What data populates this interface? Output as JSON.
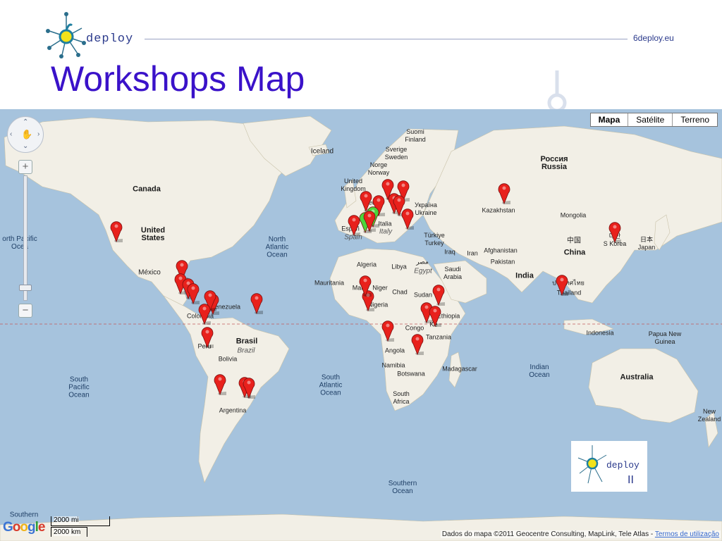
{
  "slide": {
    "brand": "deploy",
    "site": "6deploy.eu",
    "title": "Workshops Map"
  },
  "map": {
    "type_buttons": [
      "Mapa",
      "Satélite",
      "Terreno"
    ],
    "selected_type": "Mapa",
    "scale": {
      "top": "2000 mi",
      "bottom": "2000 km"
    },
    "attribution": "Dados do mapa ©2011 Geocentre Consulting, MapLink, Tele Atlas -",
    "terms_link": "Termos de utilização",
    "google_logo": "Google",
    "labels": {
      "canada": "Canada",
      "united_states": "United\nStates",
      "mexico": "México",
      "north_atlantic": "North\nAtlantic\nOcean",
      "north_pacific": "orth Pacific\nOcea",
      "venezuela": "Venezuela",
      "colombia": "Colombia",
      "peru": "Peru",
      "brasil": "Brasil",
      "brazil": "Brazil",
      "bolivia": "Bolivia",
      "argentina": "Argentina",
      "south_pacific": "South\nPacific\nOcean",
      "south_atlantic": "South\nAtlantic\nOcean",
      "southern_ocean": "Southern\nOcean",
      "southern_ocean_left": "Southern",
      "iceland": "Iceland",
      "suomi": "Suomi\nFinland",
      "sverige": "Sverige\nSweden",
      "norge": "Norge\nNorway",
      "united_kingdom": "United\nKingdom",
      "deutschland": "Deuts",
      "espana": "Españ",
      "spain": "Spain",
      "italia": "Italia",
      "italy": "Italy",
      "ukraina": "Україна\nUkraine",
      "turkiye": "Türkiye\nTurkey",
      "rossiya": "Россия\nRussia",
      "kazakhstan": "Kazakhstan",
      "mongolia": "Mongolia",
      "china_native": "中国",
      "china": "China",
      "korea_native": "대한\nS Korea",
      "japan_native": "日本\nJapan",
      "iraq": "Iraq",
      "iran": "Iran",
      "afghanistan": "Afghanistan",
      "pakistan": "Pakistan",
      "india": "India",
      "thailand": "Thailand",
      "thailand_native": "ประเทศไทย",
      "algeria": "Algeria",
      "libya": "Libya",
      "egypt_native": "مصر",
      "egypt": "Egypt",
      "saudi": "Saudi\nArabia",
      "mauritania": "Mauritania",
      "mali": "Mali",
      "niger": "Niger",
      "chad": "Chad",
      "sudan": "Sudan",
      "ethiopia": "Ethiopia",
      "nigeria": "Nigeria",
      "congo": "Congo",
      "kenya": "Ke",
      "tanzania": "Tanzania",
      "angola": "Angola",
      "namibia": "Namibia",
      "botswana": "Botswana",
      "madagascar": "Madagascar",
      "south_africa": "South\nAfrica",
      "indian_ocean": "Indian\nOcean",
      "indonesia": "Indonesia",
      "papua": "Papua New\nGuinea",
      "australia": "Australia",
      "new_zealand": "New\nZealand"
    },
    "marker_colors": {
      "red": "#e8211c",
      "green": "#4cd53a"
    },
    "markers": [
      {
        "lon": -122.4,
        "lat": 37.8,
        "color": "red"
      },
      {
        "lon": -89.6,
        "lat": 21.0,
        "color": "red"
      },
      {
        "lon": -90.5,
        "lat": 14.6,
        "color": "red"
      },
      {
        "lon": -86.3,
        "lat": 12.1,
        "color": "red"
      },
      {
        "lon": -84.1,
        "lat": 9.9,
        "color": "red"
      },
      {
        "lon": -74.1,
        "lat": 4.7,
        "color": "red"
      },
      {
        "lon": -75.5,
        "lat": 6.2,
        "color": "red"
      },
      {
        "lon": -78.5,
        "lat": -0.2,
        "color": "red"
      },
      {
        "lon": -77.0,
        "lat": -12.0,
        "color": "red"
      },
      {
        "lon": -52.3,
        "lat": 4.9,
        "color": "red"
      },
      {
        "lon": -70.6,
        "lat": -33.4,
        "color": "red"
      },
      {
        "lon": -58.4,
        "lat": -34.6,
        "color": "red"
      },
      {
        "lon": -56.2,
        "lat": -34.9,
        "color": "red"
      },
      {
        "lon": 13.4,
        "lat": 52.5,
        "color": "red"
      },
      {
        "lon": 21.0,
        "lat": 52.2,
        "color": "red"
      },
      {
        "lon": 8.7,
        "lat": 47.4,
        "color": "red"
      },
      {
        "lon": -3.7,
        "lat": 40.4,
        "color": "red"
      },
      {
        "lon": 2.3,
        "lat": 48.9,
        "color": "red"
      },
      {
        "lon": 2.2,
        "lat": 41.4,
        "color": "green"
      },
      {
        "lon": 6.0,
        "lat": 43.5,
        "color": "green"
      },
      {
        "lon": 4.0,
        "lat": 42.0,
        "color": "red"
      },
      {
        "lon": 16.4,
        "lat": 48.2,
        "color": "red"
      },
      {
        "lon": 19.0,
        "lat": 47.5,
        "color": "red"
      },
      {
        "lon": 23.3,
        "lat": 42.7,
        "color": "red"
      },
      {
        "lon": 71.4,
        "lat": 51.2,
        "color": "red"
      },
      {
        "lon": 126.9,
        "lat": 37.6,
        "color": "red"
      },
      {
        "lon": 100.5,
        "lat": 13.8,
        "color": "red"
      },
      {
        "lon": 3.4,
        "lat": 6.5,
        "color": "red"
      },
      {
        "lon": 2.1,
        "lat": 13.5,
        "color": "red"
      },
      {
        "lon": 38.7,
        "lat": 9.0,
        "color": "red"
      },
      {
        "lon": 32.6,
        "lat": 0.3,
        "color": "red"
      },
      {
        "lon": 36.8,
        "lat": -1.3,
        "color": "red"
      },
      {
        "lon": 13.2,
        "lat": -8.8,
        "color": "red"
      },
      {
        "lon": 28.3,
        "lat": -15.4,
        "color": "red"
      }
    ]
  }
}
